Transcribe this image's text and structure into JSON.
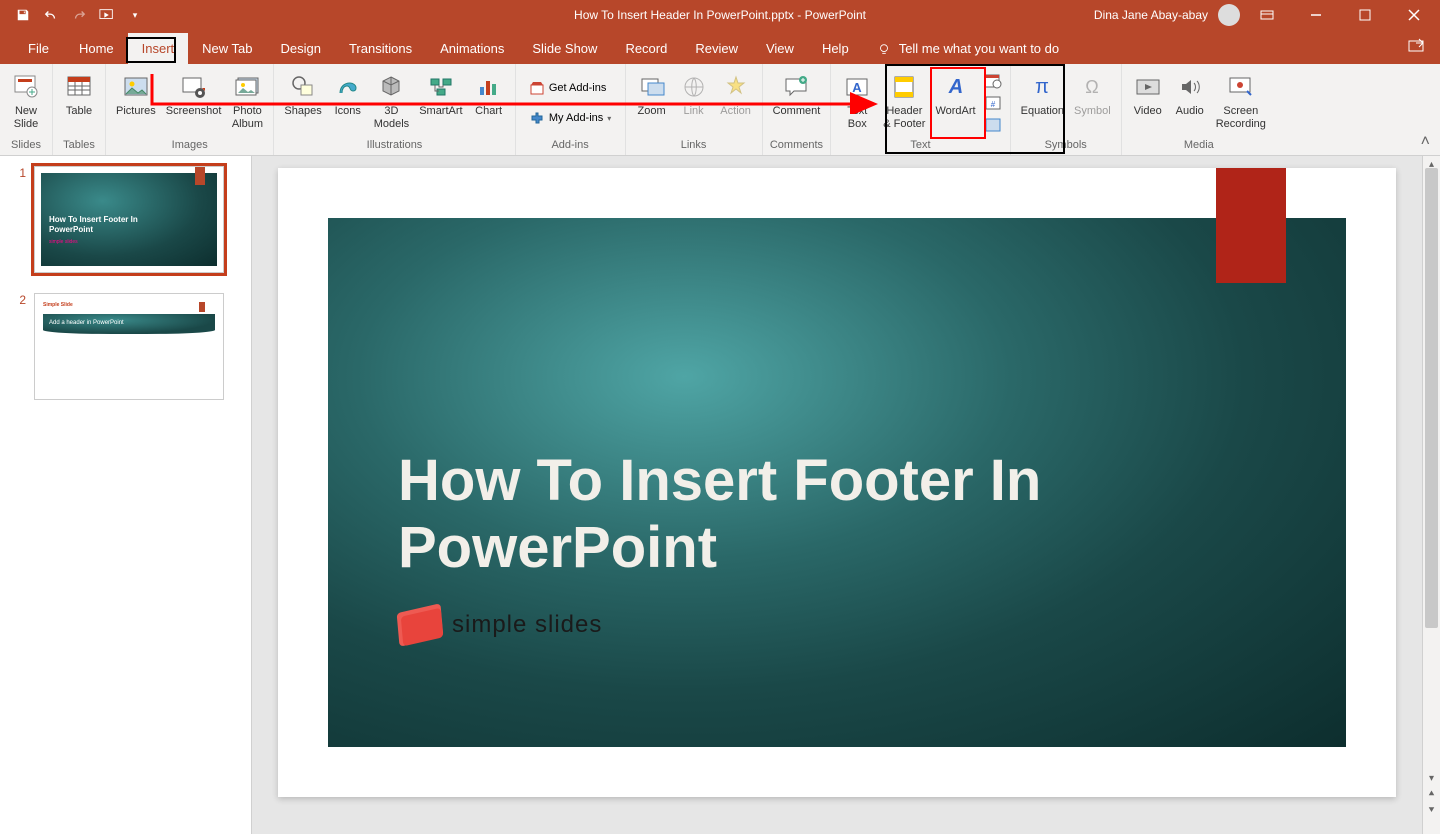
{
  "title": "How To Insert Header In PowerPoint.pptx  -  PowerPoint",
  "user": "Dina Jane Abay-abay",
  "tabs": {
    "file": "File",
    "home": "Home",
    "insert": "Insert",
    "newtab": "New Tab",
    "design": "Design",
    "transitions": "Transitions",
    "animations": "Animations",
    "slideshow": "Slide Show",
    "record": "Record",
    "review": "Review",
    "view": "View",
    "help": "Help",
    "tellme": "Tell me what you want to do"
  },
  "groups": {
    "slides": "Slides",
    "tables": "Tables",
    "images": "Images",
    "illustrations": "Illustrations",
    "addins": "Add-ins",
    "links": "Links",
    "comments": "Comments",
    "text": "Text",
    "symbols": "Symbols",
    "media": "Media"
  },
  "btn": {
    "newslide": "New\nSlide",
    "table": "Table",
    "pictures": "Pictures",
    "screenshot": "Screenshot",
    "photoalbum": "Photo\nAlbum",
    "shapes": "Shapes",
    "icons": "Icons",
    "models": "3D\nModels",
    "smartart": "SmartArt",
    "chart": "Chart",
    "getaddins": "Get Add-ins",
    "myaddins": "My Add-ins",
    "zoom": "Zoom",
    "link": "Link",
    "action": "Action",
    "comment": "Comment",
    "textbox": "Text\nBox",
    "headerfooter": "Header\n& Footer",
    "wordart": "WordArt",
    "equation": "Equation",
    "symbol": "Symbol",
    "video": "Video",
    "audio": "Audio",
    "screenrec": "Screen\nRecording"
  },
  "thumbs": {
    "n1": "1",
    "n2": "2",
    "t1": "How To Insert Footer In\nPowerPoint",
    "t1logo": "simple slides",
    "t2h": "Simple Slide",
    "t2": "Add a header in PowerPoint"
  },
  "slide": {
    "title": "How To Insert Footer In\nPowerPoint",
    "logo": "simple slides"
  }
}
